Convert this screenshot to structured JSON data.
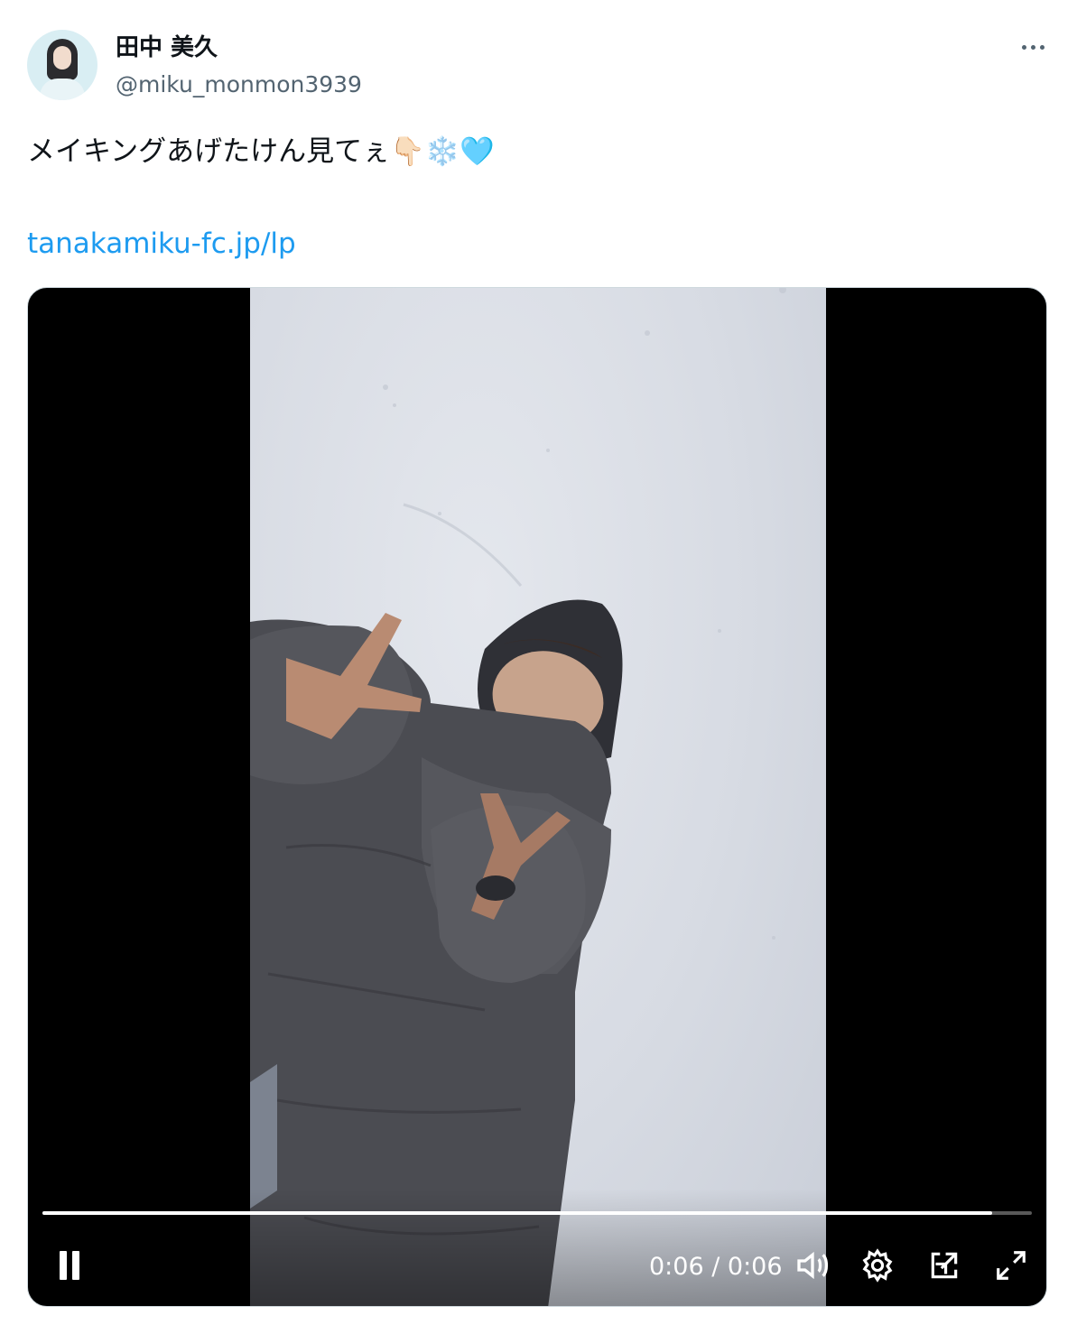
{
  "author": {
    "name": "田中 美久",
    "handle": "@miku_monmon3939"
  },
  "tweet": {
    "text": "メイキングあげたけん見てぇ👇🏻❄️🩵",
    "link": "tanakamiku-fc.jp/lp"
  },
  "video": {
    "time_display": "0:06 / 0:06",
    "progress": 0.96,
    "state": "playing"
  },
  "icons": [
    "more-icon",
    "pause-icon",
    "volume-icon",
    "settings-gear-icon",
    "pip-icon",
    "fullscreen-icon"
  ],
  "colors": {
    "link": "#1d9bf0",
    "handle": "#536471",
    "video_bg": "#000000",
    "snow": "#d7dbe3",
    "jacket": "#4b4c52"
  }
}
